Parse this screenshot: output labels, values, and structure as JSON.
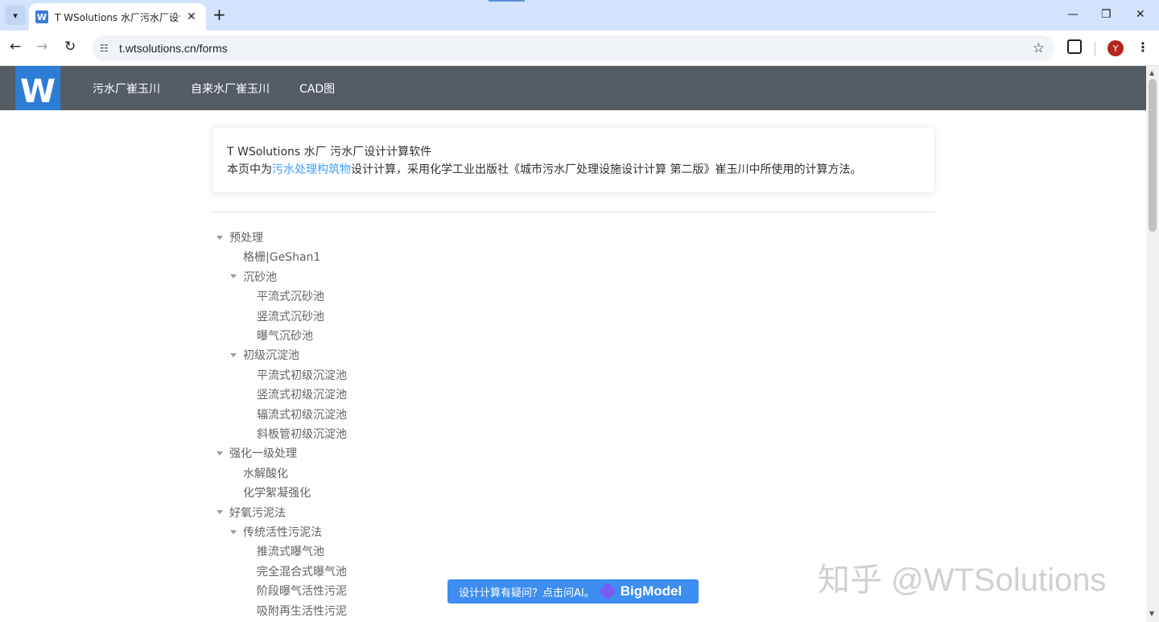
{
  "browser": {
    "tab_title": "T WSolutions 水厂污水厂设计",
    "tab_favicon": "W",
    "tab_close": "✕",
    "new_tab": "+",
    "url": "t.wtsolutions.cn/forms",
    "avatar_letter": "Y",
    "window_controls": [
      "—",
      "❐",
      "✕"
    ]
  },
  "site": {
    "logo": "W",
    "nav": [
      "污水厂崔玉川",
      "自来水厂崔玉川",
      "CAD图"
    ]
  },
  "intro": {
    "title": "T WSolutions 水厂 污水厂设计计算软件",
    "prefix": "本页中为",
    "link": "污水处理构筑物",
    "suffix": "设计计算，采用化学工业出版社《城市污水厂处理设施设计计算 第二版》崔玉川中所使用的计算方法。"
  },
  "tree": [
    {
      "label": "预处理",
      "level": 0,
      "expanded": true
    },
    {
      "label": "格栅|GeShan1",
      "level": 1,
      "expanded": null
    },
    {
      "label": "沉砂池",
      "level": 1,
      "expanded": true
    },
    {
      "label": "平流式沉砂池",
      "level": 2,
      "expanded": null
    },
    {
      "label": "竖流式沉砂池",
      "level": 2,
      "expanded": null
    },
    {
      "label": "曝气沉砂池",
      "level": 2,
      "expanded": null
    },
    {
      "label": "初级沉淀池",
      "level": 1,
      "expanded": true
    },
    {
      "label": "平流式初级沉淀池",
      "level": 2,
      "expanded": null
    },
    {
      "label": "竖流式初级沉淀池",
      "level": 2,
      "expanded": null
    },
    {
      "label": "辐流式初级沉淀池",
      "level": 2,
      "expanded": null
    },
    {
      "label": "斜板管初级沉淀池",
      "level": 2,
      "expanded": null
    },
    {
      "label": "强化一级处理",
      "level": 0,
      "expanded": true
    },
    {
      "label": "水解酸化",
      "level": 1,
      "expanded": null
    },
    {
      "label": "化学絮凝强化",
      "level": 1,
      "expanded": null
    },
    {
      "label": "好氧污泥法",
      "level": 0,
      "expanded": true
    },
    {
      "label": "传统活性污泥法",
      "level": 1,
      "expanded": true
    },
    {
      "label": "推流式曝气池",
      "level": 2,
      "expanded": null
    },
    {
      "label": "完全混合式曝气池",
      "level": 2,
      "expanded": null
    },
    {
      "label": "阶段曝气活性污泥",
      "level": 2,
      "expanded": null
    },
    {
      "label": "吸附再生活性污泥",
      "level": 2,
      "expanded": null
    }
  ],
  "ai_button": {
    "text": "设计计算有疑问？点击问AI。",
    "brand": "BigModel"
  },
  "watermark": "知乎 @WTSolutions",
  "colors": {
    "navbar": "#545c64",
    "logo": "#2b7dd6",
    "link": "#409eff",
    "ai_button": "#3d8ef0"
  }
}
